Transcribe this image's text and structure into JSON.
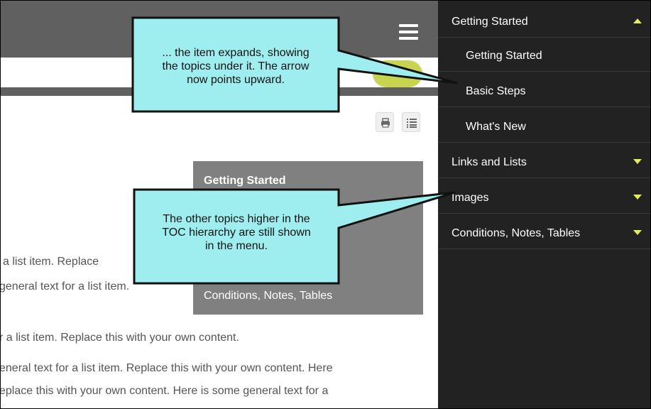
{
  "header": {
    "menu_icon": "hamburger-menu-icon"
  },
  "search": {
    "placeholder": ""
  },
  "toolbar": {
    "print_icon": "print-icon",
    "toc_icon": "list-icon"
  },
  "mini_toc": {
    "items": [
      "Getting Started",
      "Conditions, Notes, Tables"
    ]
  },
  "body": {
    "lines": [
      "a list item. Replace",
      "general text for a list item.",
      "r a list item. Replace this with your own content.",
      "eneral text for a list item. Replace this with your own content. Here",
      "eplace this with your own content. Here is some general text for a"
    ]
  },
  "menu": {
    "items": [
      {
        "label": "Getting Started",
        "level": "top",
        "arrow": "up"
      },
      {
        "label": "Getting Started",
        "level": "sub",
        "arrow": ""
      },
      {
        "label": "Basic Steps",
        "level": "sub",
        "arrow": ""
      },
      {
        "label": "What's New",
        "level": "sub",
        "arrow": ""
      },
      {
        "label": "Links and Lists",
        "level": "top",
        "arrow": "down"
      },
      {
        "label": "Images",
        "level": "top",
        "arrow": "down"
      },
      {
        "label": "Conditions, Notes, Tables",
        "level": "top",
        "arrow": "down"
      }
    ],
    "accent": "#e2ef5a"
  },
  "callouts": [
    {
      "lines": [
        "... the item expands, showing",
        "the topics under it. The arrow",
        "now points upward."
      ]
    },
    {
      "lines": [
        "The other topics higher in the",
        "TOC hierarchy are still shown",
        "in the menu."
      ]
    }
  ],
  "colors": {
    "callout_fill": "#9eeef0",
    "header": "#606060",
    "menu_bg": "#222222",
    "search_button": "#c7d44f"
  }
}
